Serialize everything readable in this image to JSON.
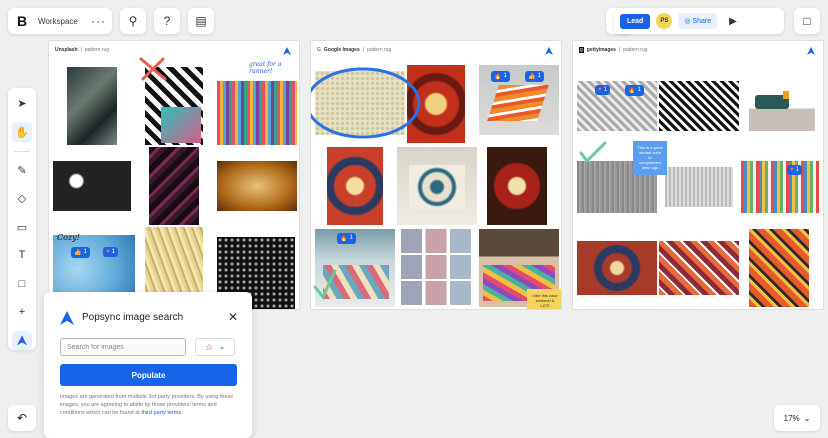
{
  "topbar": {
    "logo": "B",
    "workspace": "Workspace",
    "more": "···",
    "lead_label": "Lead",
    "avatar_initials": "PS",
    "share_label": "Share"
  },
  "frames": [
    {
      "source": "Unsplash",
      "query": "pattern rug",
      "handwriting": "great for a runner!",
      "cozy": "Cozy!",
      "badges": [
        "1",
        "1"
      ]
    },
    {
      "source": "Google Images",
      "query": "pattern rug",
      "badges": [
        "1",
        "1",
        "1"
      ],
      "sticky": "I like this color scheme! A LOT!"
    },
    {
      "source": "gettyimages",
      "query": "pattern rug",
      "badges": [
        "1",
        "1",
        "1"
      ],
      "sticky": "This is a great neutral color to complement new rugs"
    }
  ],
  "search_panel": {
    "title": "Popsync image search",
    "placeholder": "Search for images",
    "populate_label": "Populate",
    "note_prefix": "Images are generated from multiple 3rd party providers. By using these images, you are agreeing to abide by those providers' terms and conditions which can be found at ",
    "note_link": "third party terms",
    "note_suffix": "."
  },
  "zoom": {
    "level": "17%"
  },
  "colors": {
    "accent": "#1764e8",
    "lead": "#1764e8",
    "avatar": "#f6d35c",
    "sticky_yellow": "#f6d35c",
    "sticky_blue": "#5b9ef0"
  },
  "icons": [
    "cursor-icon",
    "hand-icon",
    "pencil-icon",
    "shapes-icon",
    "sticky-note-icon",
    "text-icon",
    "frame-icon",
    "plus-icon",
    "popsync-icon",
    "undo-icon",
    "search-icon",
    "help-icon",
    "present-icon",
    "magic-icon",
    "video-icon",
    "chat-icon"
  ]
}
